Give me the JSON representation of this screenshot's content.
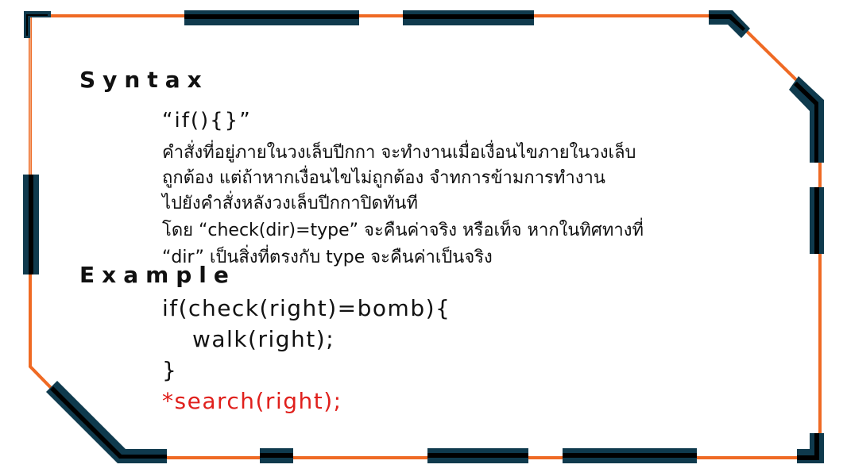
{
  "colors": {
    "border_orange": "#ef6a24",
    "border_dark": "#0f3a4d",
    "border_black": "#000000",
    "highlight_red": "#e0201c",
    "text": "#111111"
  },
  "slide": {
    "syntax_heading": "Syntax",
    "syntax_code": "“if(){}”",
    "description_lines": [
      "คำสั่งที่อยู่ภายในวงเล็บปีกกา จะทำงานเมื่อเงื่อนไขภายในวงเล็บ",
      "ถูกต้อง แต่ถ้าหากเงื่อนไขไม่ถูกต้อง จำทการข้ามการทำงาน",
      "ไปยังคำสั่งหลังวงเล็บปีกกาปิดทันที",
      "โดย “check(dir)=type” จะคืนค่าจริง หรือเท็จ หากในทิศทางที่",
      "“dir” เป็นสิ่งที่ตรงกับ type จะคืนค่าเป็นจริง"
    ],
    "example_heading": "Example",
    "example_code": [
      "if(check(right)=bomb){",
      "walk(right);",
      "}",
      "*search(right);"
    ]
  }
}
